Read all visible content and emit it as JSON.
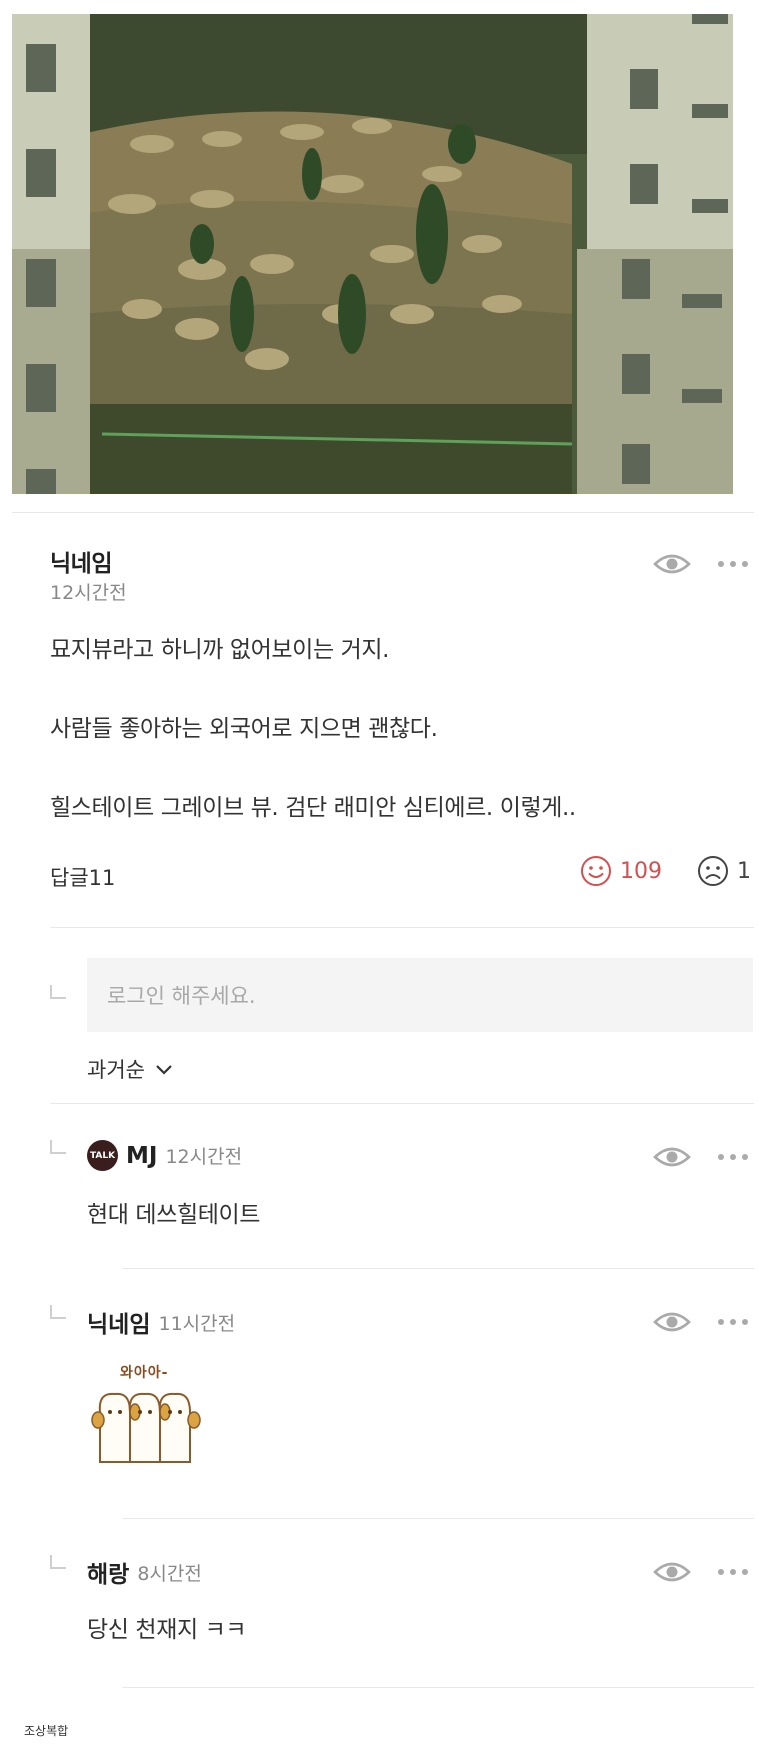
{
  "photo": {
    "alt_subject": "cemetery-hillside-between-apartments"
  },
  "comment": {
    "nickname": "닉네임",
    "time": "12시간전",
    "lines": [
      "묘지뷰라고 하니까 없어보이는 거지.",
      "사람들 좋아하는 외국어로 지으면 괜찮다.",
      "힐스테이트 그레이브 뷰. 검단 래미안 심티에르. 이렇게.."
    ],
    "reply_label": "답글11",
    "likes": "109",
    "dislikes": "1"
  },
  "reply_input": {
    "placeholder": "로그인 해주세요."
  },
  "sort": {
    "label": "과거순"
  },
  "replies": [
    {
      "nickname": "MJ",
      "time": "12시간전",
      "badge": "TALK",
      "text": "현대 데쓰힐테이트"
    },
    {
      "nickname": "닉네임",
      "time": "11시간전",
      "sticker_text": "와아아-"
    },
    {
      "nickname": "해랑",
      "time": "8시간전",
      "text": "당신 천재지 ㅋㅋ"
    }
  ],
  "footer": {
    "watermark": "조상복합"
  },
  "colors": {
    "like": "#d44f4f",
    "icon_gray": "#aaaaaa",
    "divider": "#e8e8e8",
    "talk_badge": "#3a1e1e"
  }
}
